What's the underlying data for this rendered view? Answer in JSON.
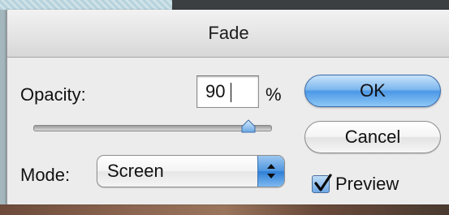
{
  "dialog": {
    "title": "Fade",
    "opacity": {
      "label": "Opacity:",
      "value": "90",
      "unit": "%",
      "slider_percent": 90
    },
    "mode": {
      "label": "Mode:",
      "selected": "Screen"
    },
    "buttons": {
      "ok_label": "OK",
      "cancel_label": "Cancel"
    },
    "preview": {
      "label": "Preview",
      "checked": true
    }
  },
  "colors": {
    "dialog_bg": "#ececec",
    "default_button": "#4c98e6",
    "select_arrow": "#2e7fd6"
  },
  "icons": {
    "select_arrows": "up-down-chevron-icon",
    "slider_thumb": "slider-thumb-icon",
    "checkmark": "checkmark-icon"
  }
}
